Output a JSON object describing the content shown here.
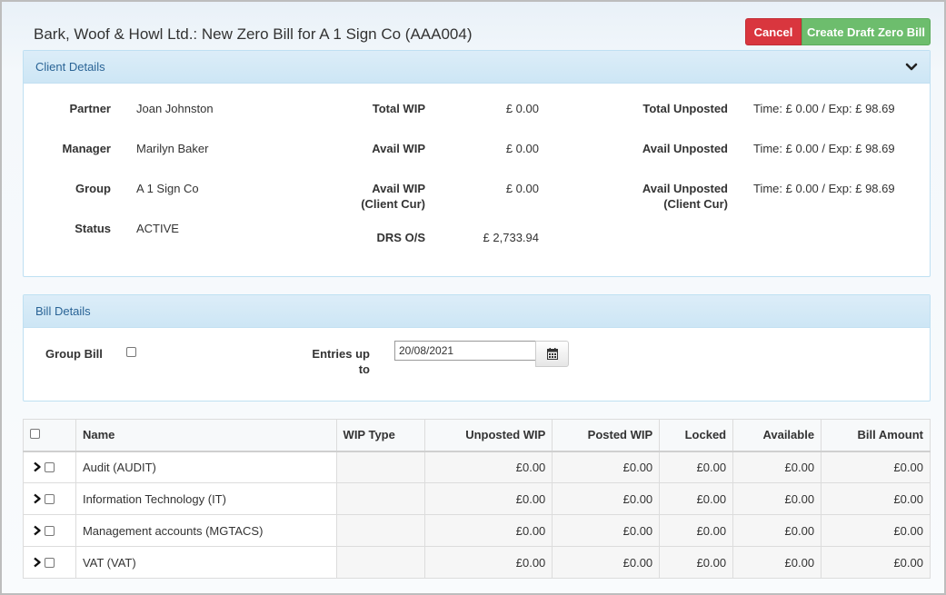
{
  "header": {
    "title": "Bark, Woof & Howl Ltd.: New Zero Bill for A 1 Sign Co (AAA004)",
    "cancel_label": "Cancel",
    "create_label": "Create Draft Zero Bill"
  },
  "client_details": {
    "title": "Client Details",
    "partner_label": "Partner",
    "partner_value": "Joan Johnston",
    "manager_label": "Manager",
    "manager_value": "Marilyn Baker",
    "group_label": "Group",
    "group_value": "A 1 Sign Co",
    "status_label": "Status",
    "status_value": "ACTIVE",
    "total_wip_label": "Total WIP",
    "total_wip_value": "£ 0.00",
    "avail_wip_label": "Avail WIP",
    "avail_wip_value": "£ 0.00",
    "avail_wip_cc_label_1": "Avail WIP",
    "avail_wip_cc_label_2": "(Client Cur)",
    "avail_wip_cc_value": "£ 0.00",
    "drs_label": "DRS O/S",
    "drs_value": "£ 2,733.94",
    "total_unposted_label": "Total Unposted",
    "total_unposted_value": "Time: £ 0.00 / Exp: £ 98.69",
    "avail_unposted_label": "Avail Unposted",
    "avail_unposted_value": "Time: £ 0.00 / Exp: £ 98.69",
    "avail_unposted_cc_label_1": "Avail Unposted",
    "avail_unposted_cc_label_2": "(Client Cur)",
    "avail_unposted_cc_value": "Time: £ 0.00 / Exp: £ 98.69"
  },
  "bill_details": {
    "title": "Bill Details",
    "group_bill_label": "Group Bill",
    "entries_label_1": "Entries up",
    "entries_label_2": "to",
    "entries_value": "20/08/2021"
  },
  "table": {
    "columns": {
      "name": "Name",
      "wip_type": "WIP Type",
      "unposted": "Unposted WIP",
      "posted": "Posted WIP",
      "locked": "Locked",
      "available": "Available",
      "bill_amount": "Bill Amount"
    },
    "rows": [
      {
        "name": "Audit (AUDIT)",
        "wip_type": "",
        "unposted": "£0.00",
        "posted": "£0.00",
        "locked": "£0.00",
        "available": "£0.00",
        "bill_amount": "£0.00"
      },
      {
        "name": "Information Technology (IT)",
        "wip_type": "",
        "unposted": "£0.00",
        "posted": "£0.00",
        "locked": "£0.00",
        "available": "£0.00",
        "bill_amount": "£0.00"
      },
      {
        "name": "Management accounts (MGTACS)",
        "wip_type": "",
        "unposted": "£0.00",
        "posted": "£0.00",
        "locked": "£0.00",
        "available": "£0.00",
        "bill_amount": "£0.00"
      },
      {
        "name": "VAT (VAT)",
        "wip_type": "",
        "unposted": "£0.00",
        "posted": "£0.00",
        "locked": "£0.00",
        "available": "£0.00",
        "bill_amount": "£0.00"
      }
    ]
  }
}
